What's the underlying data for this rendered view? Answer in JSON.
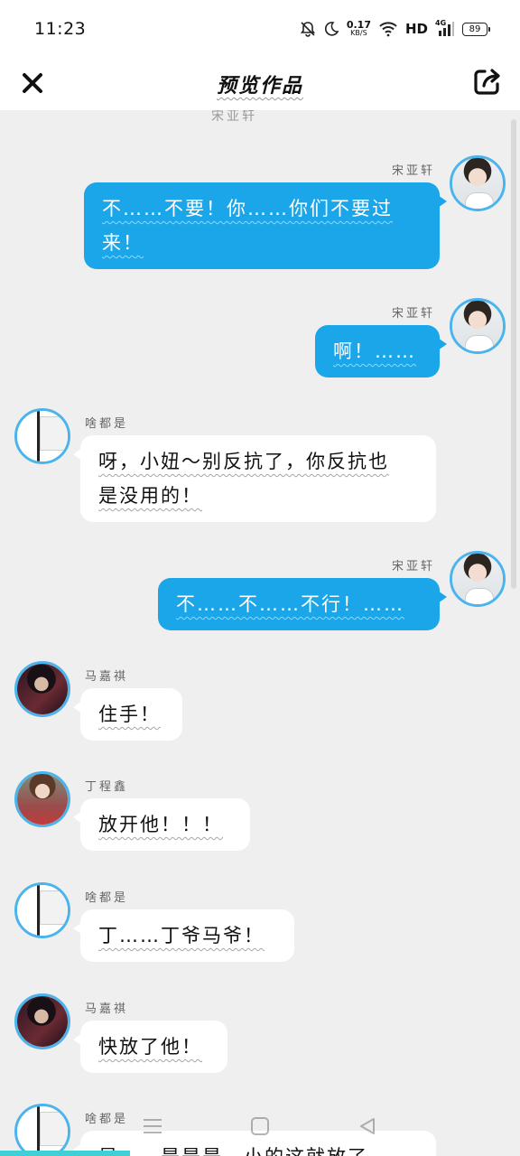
{
  "status_bar": {
    "time": "11:23",
    "net_speed_value": "0.17",
    "net_speed_unit": "KB/S",
    "hd": "HD",
    "network": "4G",
    "battery": "89",
    "icons": [
      "mute-bell-icon",
      "moon-icon",
      "wifi-icon",
      "signal-icon",
      "battery-icon"
    ]
  },
  "app_bar": {
    "title": "预览作品",
    "close_icon": "close-icon",
    "share_icon": "share-icon"
  },
  "chat": {
    "partial_top_name": "宋亚轩",
    "accent": "#1aa6e8",
    "messages": [
      {
        "side": "right",
        "name": "宋亚轩",
        "avatar": "boy-avatar",
        "lines": [
          "不……不要！你……你们不要过",
          "来！"
        ]
      },
      {
        "side": "right",
        "name": "宋亚轩",
        "avatar": "boy-avatar",
        "lines": [
          "啊！……"
        ]
      },
      {
        "side": "left",
        "name": "啥都是",
        "avatar": "flag-avatar",
        "lines": [
          "呀，小妞～别反抗了，你反抗也",
          "是没用的！"
        ]
      },
      {
        "side": "right",
        "name": "宋亚轩",
        "avatar": "boy-avatar",
        "lines": [
          "不……不……不行！……"
        ]
      },
      {
        "side": "left",
        "name": "马嘉祺",
        "avatar": "dark-avatar",
        "lines": [
          "住手！"
        ]
      },
      {
        "side": "left",
        "name": "丁程鑫",
        "avatar": "red-avatar",
        "lines": [
          "放开他！！！"
        ]
      },
      {
        "side": "left",
        "name": "啥都是",
        "avatar": "flag-avatar",
        "lines": [
          "丁……丁爷马爷！"
        ]
      },
      {
        "side": "left",
        "name": "马嘉祺",
        "avatar": "dark-avatar",
        "lines": [
          "快放了他！"
        ]
      },
      {
        "side": "left",
        "name": "啥都是",
        "avatar": "flag-avatar",
        "lines": [
          "是……是是是，小的这就放了"
        ]
      }
    ]
  },
  "nav_bar": {
    "icons": [
      "menu-icon",
      "home-icon",
      "back-icon"
    ]
  }
}
